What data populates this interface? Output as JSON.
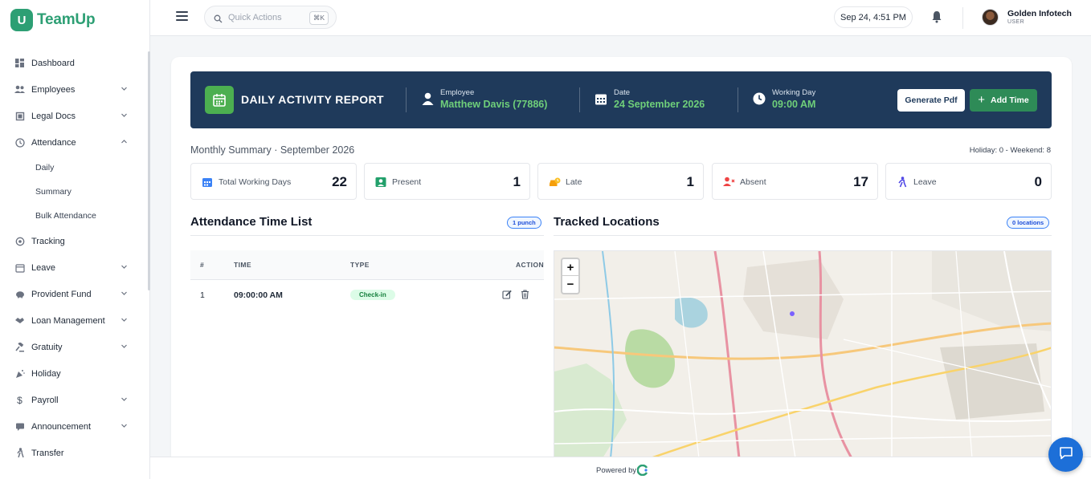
{
  "app": {
    "name": "TeamUp",
    "logo_letter": "U"
  },
  "sidebar": {
    "items": [
      {
        "label": "Dashboard",
        "icon": "dashboard-icon",
        "has_chevron": false
      },
      {
        "label": "Employees",
        "icon": "users-icon",
        "has_chevron": true
      },
      {
        "label": "Legal Docs",
        "icon": "document-icon",
        "has_chevron": true
      },
      {
        "label": "Attendance",
        "icon": "clock-icon",
        "has_chevron": true,
        "expanded": true
      },
      {
        "label": "Tracking",
        "icon": "target-icon",
        "has_chevron": false
      },
      {
        "label": "Leave",
        "icon": "calendar-icon",
        "has_chevron": true
      },
      {
        "label": "Provident Fund",
        "icon": "piggy-bank-icon",
        "has_chevron": true
      },
      {
        "label": "Loan Management",
        "icon": "handshake-icon",
        "has_chevron": true
      },
      {
        "label": "Gratuity",
        "icon": "gavel-icon",
        "has_chevron": true
      },
      {
        "label": "Holiday",
        "icon": "party-icon",
        "has_chevron": false
      },
      {
        "label": "Payroll",
        "icon": "dollar-icon",
        "has_chevron": true
      },
      {
        "label": "Announcement",
        "icon": "megaphone-icon",
        "has_chevron": true
      },
      {
        "label": "Transfer",
        "icon": "walking-icon",
        "has_chevron": false
      }
    ],
    "attendance_subitems": [
      "Daily",
      "Summary",
      "Bulk Attendance"
    ]
  },
  "topbar": {
    "search_placeholder": "Quick Actions",
    "search_shortcut": "⌘K",
    "datetime": "Sep 24, 4:51 PM",
    "user_name": "Golden Infotech",
    "user_role": "USER"
  },
  "banner": {
    "title": "DAILY ACTIVITY REPORT",
    "employee_label": "Employee",
    "employee_value": "Matthew Davis (77886)",
    "date_label": "Date",
    "date_value": "24 September 2026",
    "working_label": "Working Day",
    "working_value": "09:00 AM",
    "generate_pdf": "Generate Pdf",
    "add_time": "Add Time"
  },
  "summary": {
    "title": "Monthly Summary · September 2026",
    "holiday_weekend": "Holiday: 0 - Weekend: 8",
    "stats": [
      {
        "label": "Total Working Days",
        "value": "22",
        "icon": "calendar-icon",
        "color": "#3b82f6"
      },
      {
        "label": "Present",
        "value": "1",
        "icon": "user-check-icon",
        "color": "#22a06b"
      },
      {
        "label": "Late",
        "value": "1",
        "icon": "late-car-icon",
        "color": "#f59e0b"
      },
      {
        "label": "Absent",
        "value": "17",
        "icon": "user-x-icon",
        "color": "#ef4444"
      },
      {
        "label": "Leave",
        "value": "0",
        "icon": "walking-icon",
        "color": "#4f46e5"
      }
    ]
  },
  "attendance_list": {
    "title": "Attendance Time List",
    "badge": "1 punch",
    "columns": [
      "#",
      "TIME",
      "TYPE",
      "ACTION"
    ],
    "rows": [
      {
        "num": "1",
        "time": "09:00:00 AM",
        "type": "Check-in"
      }
    ]
  },
  "locations": {
    "title": "Tracked Locations",
    "badge": "0 locations",
    "zoom_in": "+",
    "zoom_out": "−"
  },
  "footer": {
    "text": "Powered by"
  },
  "colors": {
    "brand": "#2d9f74",
    "banner_bg": "#1f3a5b",
    "accent_green": "#6fcf7a",
    "primary_btn": "#2e8b57",
    "chat": "#1d6fd8"
  }
}
